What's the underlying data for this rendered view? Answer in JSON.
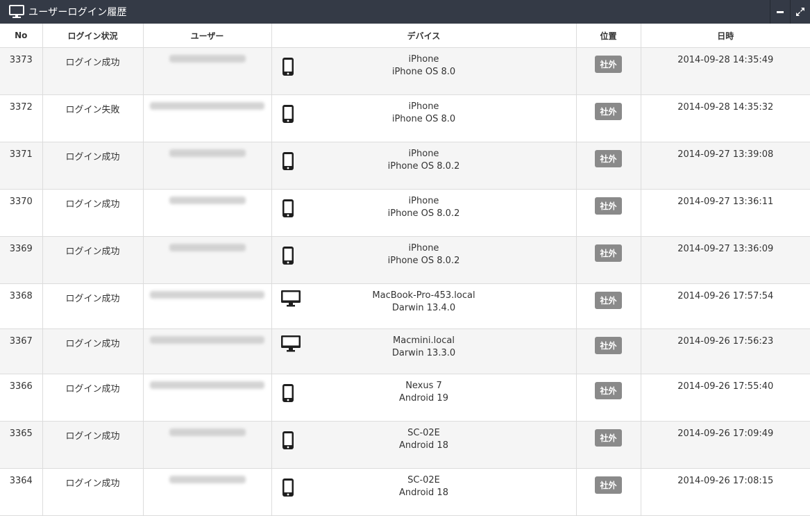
{
  "panel": {
    "title": "ユーザーログイン履歴"
  },
  "columns": {
    "no": "No",
    "status": "ログイン状況",
    "user": "ユーザー",
    "device": "デバイス",
    "location": "位置",
    "datetime": "日時"
  },
  "rows": [
    {
      "no": "3373",
      "status": "ログイン成功",
      "device_type": "phone-icon",
      "device_name": "iPhone",
      "device_os": "iPhone OS 8.0",
      "location": "社外",
      "datetime": "2014-09-28 14:35:49"
    },
    {
      "no": "3372",
      "status": "ログイン失敗",
      "device_type": "phone-icon",
      "device_name": "iPhone",
      "device_os": "iPhone OS 8.0",
      "location": "社外",
      "datetime": "2014-09-28 14:35:32"
    },
    {
      "no": "3371",
      "status": "ログイン成功",
      "device_type": "phone-icon",
      "device_name": "iPhone",
      "device_os": "iPhone OS 8.0.2",
      "location": "社外",
      "datetime": "2014-09-27 13:39:08"
    },
    {
      "no": "3370",
      "status": "ログイン成功",
      "device_type": "phone-icon",
      "device_name": "iPhone",
      "device_os": "iPhone OS 8.0.2",
      "location": "社外",
      "datetime": "2014-09-27 13:36:11"
    },
    {
      "no": "3369",
      "status": "ログイン成功",
      "device_type": "phone-icon",
      "device_name": "iPhone",
      "device_os": "iPhone OS 8.0.2",
      "location": "社外",
      "datetime": "2014-09-27 13:36:09"
    },
    {
      "no": "3368",
      "status": "ログイン成功",
      "device_type": "desktop-icon",
      "device_name": "MacBook-Pro-453.local",
      "device_os": "Darwin 13.4.0",
      "location": "社外",
      "datetime": "2014-09-26 17:57:54"
    },
    {
      "no": "3367",
      "status": "ログイン成功",
      "device_type": "desktop-icon",
      "device_name": "Macmini.local",
      "device_os": "Darwin 13.3.0",
      "location": "社外",
      "datetime": "2014-09-26 17:56:23"
    },
    {
      "no": "3366",
      "status": "ログイン成功",
      "device_type": "phone-icon",
      "device_name": "Nexus 7",
      "device_os": "Android 19",
      "location": "社外",
      "datetime": "2014-09-26 17:55:40"
    },
    {
      "no": "3365",
      "status": "ログイン成功",
      "device_type": "phone-icon",
      "device_name": "SC-02E",
      "device_os": "Android 18",
      "location": "社外",
      "datetime": "2014-09-26 17:09:49"
    },
    {
      "no": "3364",
      "status": "ログイン成功",
      "device_type": "phone-icon",
      "device_name": "SC-02E",
      "device_os": "Android 18",
      "location": "社外",
      "datetime": "2014-09-26 17:08:15"
    }
  ],
  "colors": {
    "header_bg": "#343a46",
    "badge_bg": "#8a8a8a",
    "row_alt": "#f5f5f5"
  }
}
